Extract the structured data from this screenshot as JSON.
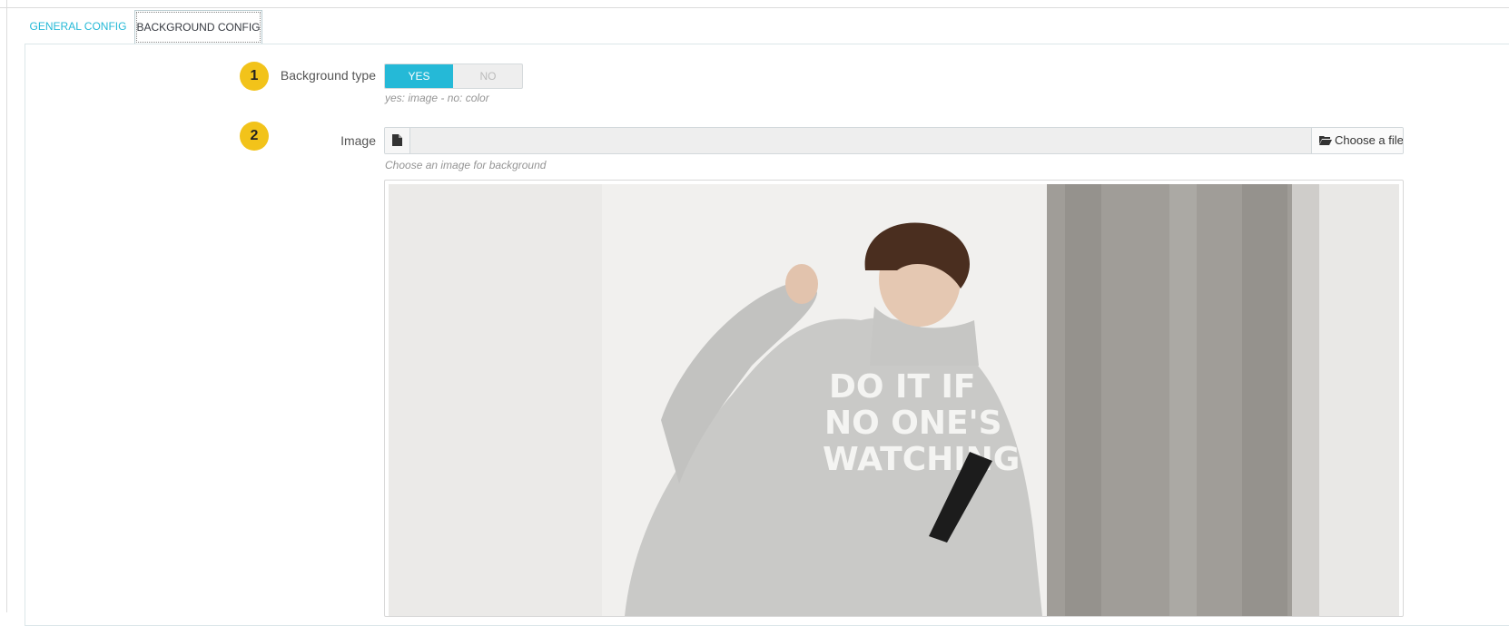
{
  "tabs": [
    {
      "label": "GENERAL CONFIG",
      "active": false
    },
    {
      "label": "BACKGROUND CONFIG",
      "active": true
    }
  ],
  "form": {
    "background_type": {
      "step": "1",
      "label": "Background type",
      "yes_label": "YES",
      "no_label": "NO",
      "selected": "YES",
      "help": "yes: image - no: color"
    },
    "image": {
      "step": "2",
      "label": "Image",
      "file_value": "",
      "choose_label": "Choose a file",
      "help": "Choose an image for background"
    },
    "preview": {
      "shirt_text": [
        "DO IT IF",
        "NO ONE'S",
        "WATCHING"
      ]
    }
  },
  "colors": {
    "accent": "#25b9d7",
    "badge": "#f2c31a"
  },
  "icons": {
    "file_addon": "file-icon",
    "choose_button": "folder-open-icon"
  }
}
